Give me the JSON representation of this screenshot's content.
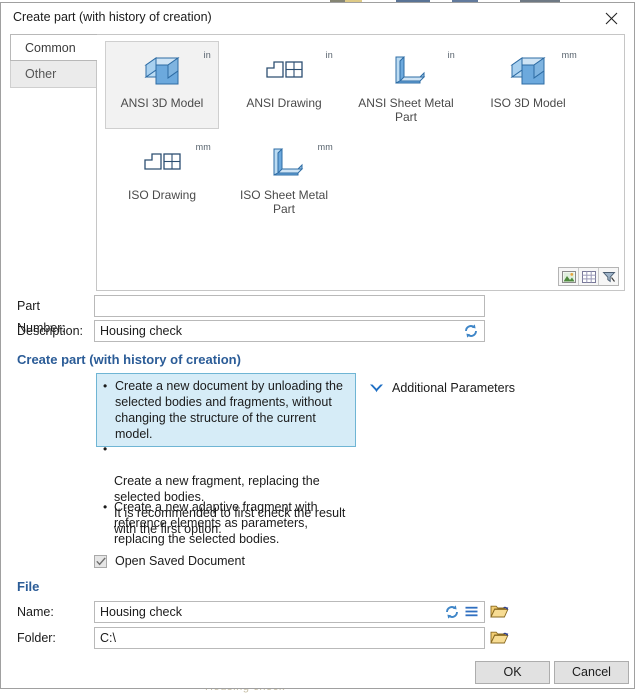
{
  "window": {
    "title": "Create part (with history of creation)",
    "close_icon": "close-icon"
  },
  "tabs": [
    {
      "label": "Common",
      "active": true
    },
    {
      "label": "Other",
      "active": false
    }
  ],
  "gallery": {
    "items": [
      {
        "label": "ANSI 3D Model",
        "unit": "in",
        "icon": "3d-model-icon",
        "selected": true
      },
      {
        "label": "ANSI Drawing",
        "unit": "in",
        "icon": "drawing-icon",
        "selected": false
      },
      {
        "label": "ANSI Sheet Metal Part",
        "unit": "in",
        "icon": "sheet-metal-icon",
        "selected": false
      },
      {
        "label": "ISO 3D Model",
        "unit": "mm",
        "icon": "3d-model-icon",
        "selected": false
      },
      {
        "label": "ISO Drawing",
        "unit": "mm",
        "icon": "drawing-icon",
        "selected": false
      },
      {
        "label": "ISO Sheet Metal Part",
        "unit": "mm",
        "icon": "sheet-metal-icon",
        "selected": false
      }
    ],
    "view_toggles": [
      {
        "name": "thumbnail-view-icon"
      },
      {
        "name": "grid-view-icon"
      },
      {
        "name": "filter-icon"
      }
    ]
  },
  "fields": {
    "part_number": {
      "label": "Part Number:",
      "value": "",
      "placeholder": ""
    },
    "description": {
      "label": "Description:",
      "value": "Housing check",
      "placeholder": "",
      "refresh_icon": "refresh-icon"
    }
  },
  "create_section": {
    "heading": "Create part (with history of creation)",
    "options": [
      {
        "text": "Create a new document by unloading the selected bodies and fragments, without changing the structure of the current model.",
        "selected": true
      },
      {
        "text": "Create a new fragment, replacing the selected bodies.\nIt is recommended to first check the result with the first option.",
        "selected": false
      },
      {
        "text": "Create a new adaptive fragment with reference elements as parameters, replacing the selected bodies.",
        "selected": false
      }
    ],
    "additional_parameters": {
      "label": "Additional Parameters",
      "chevron_icon": "chevron-down-icon"
    },
    "open_saved_document": {
      "label": "Open Saved Document",
      "checked": true
    }
  },
  "file_section": {
    "heading": "File",
    "name": {
      "label": "Name:",
      "value": "Housing check",
      "refresh_icon": "refresh-icon",
      "menu_icon": "list-menu-icon",
      "browse_icon": "open-folder-icon"
    },
    "folder": {
      "label": "Folder:",
      "value": "C:\\",
      "browse_icon": "open-folder-icon"
    }
  },
  "footer": {
    "ok_label": "OK",
    "cancel_label": "Cancel"
  },
  "background": {
    "ghost_text": "Housing check"
  },
  "colors": {
    "accent_blue": "#2b5c97",
    "selection_fill": "#d6ecf7",
    "selection_border": "#6fb5d4",
    "icon_blue": "#3f86c8",
    "folder_yellow": "#f0c75e"
  }
}
